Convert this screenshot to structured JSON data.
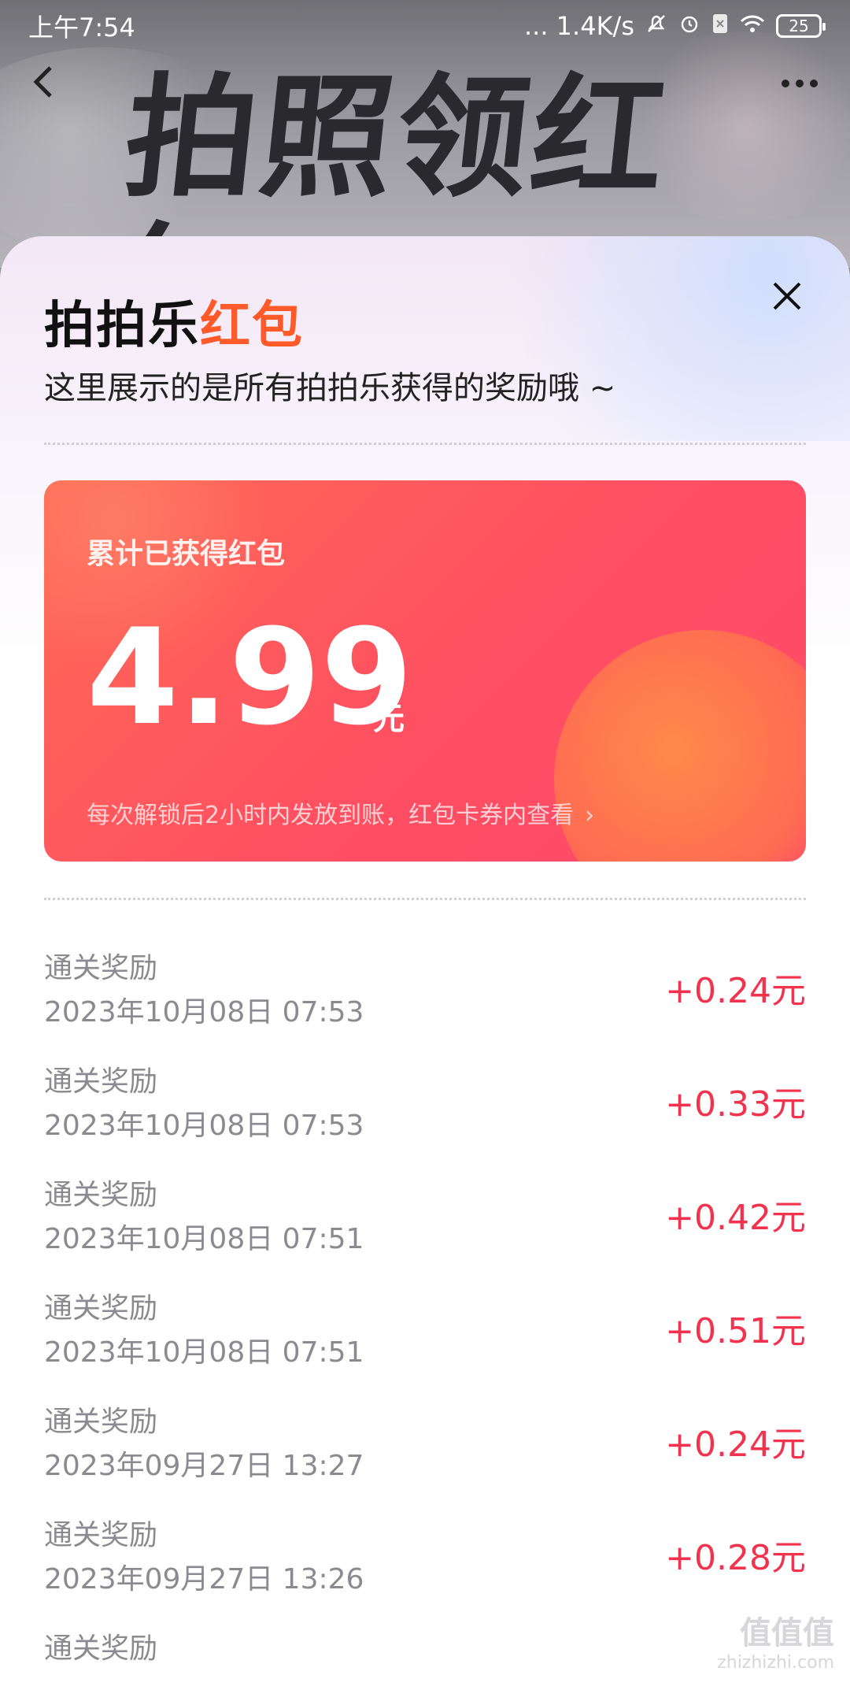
{
  "status_bar": {
    "time": "上午7:54",
    "network": "... 1.4K/s",
    "battery": "25"
  },
  "header": {
    "hero_title": "拍照领红包"
  },
  "panel": {
    "title_main": "拍拍乐",
    "title_accent": "红包",
    "subtitle": "这里展示的是所有拍拍乐获得的奖励哦 ~"
  },
  "card": {
    "label": "累计已获得红包",
    "amount": "4.99",
    "unit": "元",
    "note": "每次解锁后2小时内发放到账，红包卡券内查看",
    "note_chevron": "›"
  },
  "rewards": [
    {
      "title": "通关奖励",
      "date": "2023年10月08日 07:53",
      "amount": "+0.24元"
    },
    {
      "title": "通关奖励",
      "date": "2023年10月08日 07:53",
      "amount": "+0.33元"
    },
    {
      "title": "通关奖励",
      "date": "2023年10月08日 07:51",
      "amount": "+0.42元"
    },
    {
      "title": "通关奖励",
      "date": "2023年10月08日 07:51",
      "amount": "+0.51元"
    },
    {
      "title": "通关奖励",
      "date": "2023年09月27日 13:27",
      "amount": "+0.24元"
    },
    {
      "title": "通关奖励",
      "date": "2023年09月27日 13:26",
      "amount": "+0.28元"
    },
    {
      "title": "通关奖励",
      "date": "",
      "amount": ""
    }
  ],
  "watermark": {
    "main": "值值值",
    "sub": "zhizhizhi.com"
  },
  "colors": {
    "accent_orange": "#ff5b2a",
    "card_red": "#ff4f62",
    "amount_red": "#f2334d"
  },
  "icons": {
    "back": "chevron-left-icon",
    "more": "more-horizontal-icon",
    "close": "close-icon"
  }
}
